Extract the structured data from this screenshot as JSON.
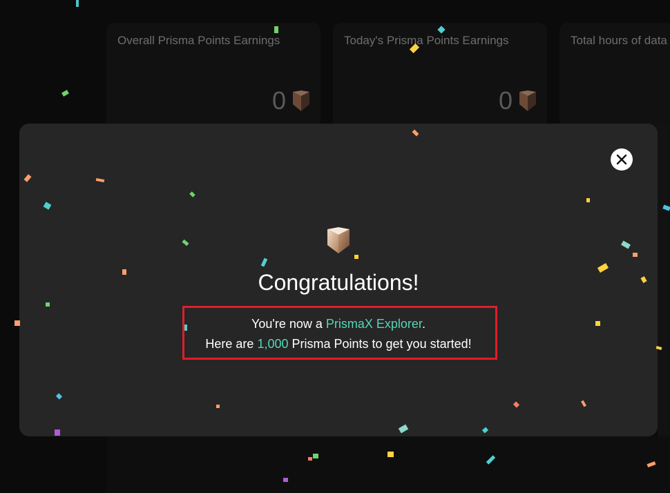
{
  "cards": [
    {
      "title": "Overall Prisma Points Earnings",
      "value": "0"
    },
    {
      "title": "Today's Prisma Points Earnings",
      "value": "0"
    },
    {
      "title": "Total hours of data",
      "value": ""
    }
  ],
  "modal": {
    "title": "Congratulations!",
    "line1_prefix": "You're now a ",
    "line1_accent": "PrismaX Explorer",
    "line1_suffix": ".",
    "line2_prefix": "Here are ",
    "line2_accent": "1,000",
    "line2_suffix": " Prisma Points to get you started!",
    "close_icon": "close-icon",
    "logo_icon": "prisma-points-icon"
  },
  "colors": {
    "accent": "#56d6b5",
    "highlight_border": "#e11d2a",
    "modal_bg": "#262626"
  }
}
